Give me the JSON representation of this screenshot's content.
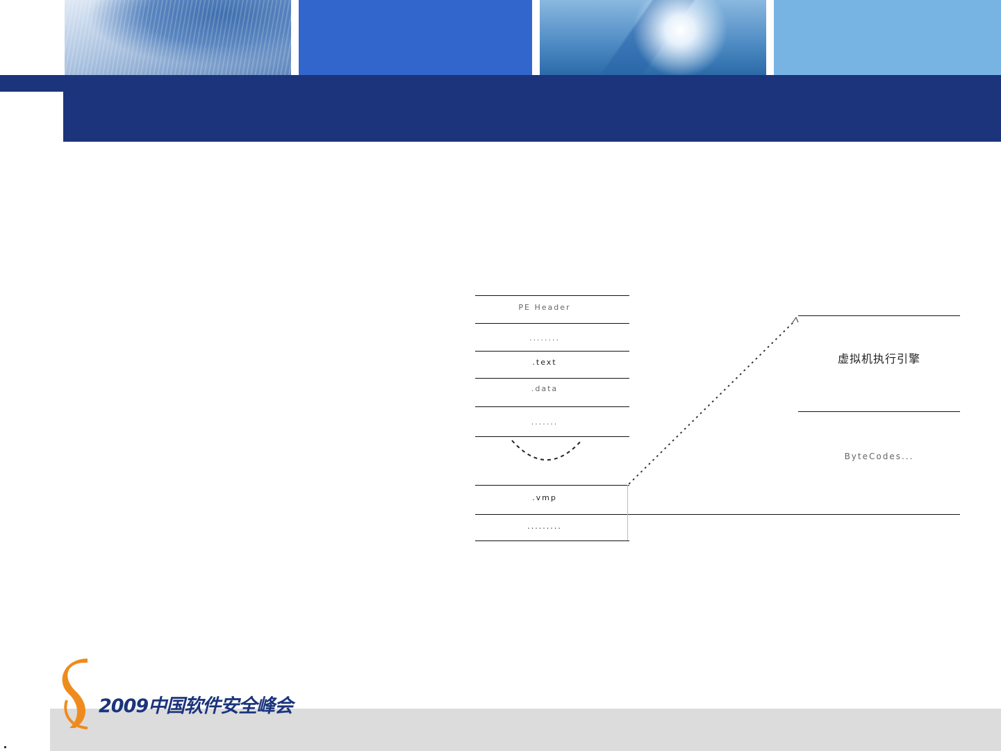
{
  "header": {
    "banner_colors": [
      "#3366cc",
      "#78b4e3",
      "#1b347c"
    ]
  },
  "diagram": {
    "pe_sections": [
      "PE Header",
      "........",
      ".text",
      ".data",
      ".......",
      "",
      ".vmp",
      "........."
    ],
    "vm_sections": [
      "虚拟机执行引擎",
      "ByteCodes..."
    ]
  },
  "footer": {
    "conference_title": "2009中国软件安全峰会"
  }
}
